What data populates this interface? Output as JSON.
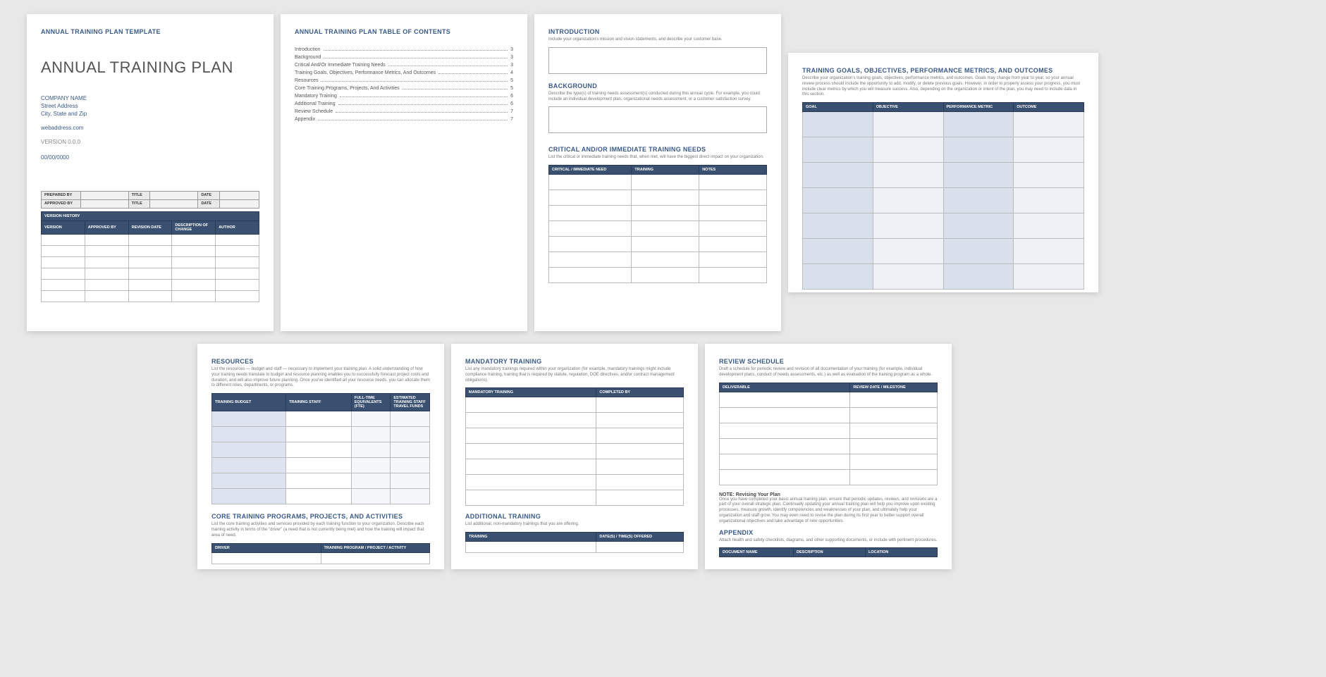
{
  "p1": {
    "top_label": "ANNUAL TRAINING PLAN TEMPLATE",
    "title": "ANNUAL TRAINING PLAN",
    "company": "COMPANY NAME",
    "addr1": "Street Address",
    "addr2": "City, State and Zip",
    "web": "webaddress.com",
    "version": "VERSION 0.0.0",
    "date": "00/00/0000",
    "sig": {
      "prepared": "PREPARED BY",
      "approved": "APPROVED BY",
      "title": "TITLE",
      "date": "DATE"
    },
    "vh_header": "VERSION HISTORY",
    "vh_cols": [
      "VERSION",
      "APPROVED BY",
      "REVISION DATE",
      "DESCRIPTION OF CHANGE",
      "AUTHOR"
    ]
  },
  "p2": {
    "title": "ANNUAL TRAINING PLAN TABLE OF CONTENTS",
    "items": [
      {
        "t": "Introduction",
        "p": "3"
      },
      {
        "t": "Background",
        "p": "3"
      },
      {
        "t": "Critical And/Or Immediate Training Needs",
        "p": "3"
      },
      {
        "t": "Training Goals, Objectives, Performance Metrics, And Outcomes",
        "p": "4"
      },
      {
        "t": "Resources",
        "p": "5"
      },
      {
        "t": "Core Training Programs, Projects, And Activities",
        "p": "5"
      },
      {
        "t": "Mandatory Training",
        "p": "6"
      },
      {
        "t": "Additional Training",
        "p": "6"
      },
      {
        "t": "Review Schedule",
        "p": "7"
      },
      {
        "t": "Appendix",
        "p": "7"
      }
    ]
  },
  "p3": {
    "intro_h": "INTRODUCTION",
    "intro_t": "Include your organization's mission and vision statements, and describe your customer base.",
    "bg_h": "BACKGROUND",
    "bg_t": "Describe the type(s) of training needs assessment(s) conducted during this annual cycle. For example, you could include an individual development plan, organizational needs assessment, or a customer satisfaction survey.",
    "crit_h": "CRITICAL AND/OR IMMEDIATE TRAINING NEEDS",
    "crit_t": "List the critical or immediate training needs that, when met, will have the biggest direct impact on your organization.",
    "crit_cols": [
      "CRITICAL / IMMEDIATE NEED",
      "TRAINING",
      "NOTES"
    ]
  },
  "p4": {
    "h": "TRAINING GOALS, OBJECTIVES, PERFORMANCE METRICS, AND OUTCOMES",
    "t": "Describe your organization's training goals, objectives, performance metrics, and outcomes. Goals may change from year to year, so your annual review process should include the opportunity to add, modify, or delete previous goals. However, in order to properly assess your progress, you must include clear metrics by which you will measure success. Also, depending on the organization or intent of the plan, you may need to include data in this section.",
    "cols": [
      "GOAL",
      "OBJECTIVE",
      "PERFORMANCE METRIC",
      "OUTCOME"
    ]
  },
  "p5": {
    "res_h": "RESOURCES",
    "res_t": "List the resources — budget and staff — necessary to implement your training plan. A solid understanding of how your training needs translate to budget and resource planning enables you to successfully forecast project costs and duration, and will also improve future planning. Once you've identified all your resource needs, you can allocate them to different roles, departments, or programs.",
    "res_cols": [
      "TRAINING BUDGET",
      "TRAINING STAFF",
      "FULL-TIME EQUIVALENTS (FTE)",
      "ESTIMATED TRAINING STAFF TRAVEL FUNDS"
    ],
    "core_h": "CORE TRAINING PROGRAMS, PROJECTS, AND ACTIVITIES",
    "core_t": "List the core training activities and services provided by each training function to your organization. Describe each training activity in terms of the \"driver\" (a need that is not currently being met) and how the training will impact that area of need.",
    "core_cols": [
      "DRIVER",
      "TRAINING PROGRAM / PROJECT / ACTIVITY"
    ]
  },
  "p6": {
    "man_h": "MANDATORY TRAINING",
    "man_t": "List any mandatory trainings required within your organization (for example, mandatory trainings might include compliance training, training that is required by statute, regulation, DOE directives, and/or contract management obligations).",
    "man_cols": [
      "MANDATORY TRAINING",
      "COMPLETED BY"
    ],
    "add_h": "ADDITIONAL TRAINING",
    "add_t": "List additional, non-mandatory trainings that you are offering.",
    "add_cols": [
      "TRAINING",
      "DATE(S) / TIME(S) OFFERED"
    ]
  },
  "p7": {
    "rev_h": "REVIEW SCHEDULE",
    "rev_t": "Draft a schedule for periodic review and revision of all documentation of your training (for example, individual development plans, conduct of needs assessments, etc.) as well as evaluation of the training program as a whole.",
    "rev_cols": [
      "DELIVERABLE",
      "REVIEW DATE / MILESTONE"
    ],
    "note_h": "NOTE: Revising Your Plan",
    "note_t": "Once you have completed your basic annual training plan, ensure that periodic updates, reviews, and revisions are a part of your overall strategic plan. Continually updating your annual training plan will help you improve upon existing processes, measure growth, identify competencies and weaknesses of your plan, and ultimately help your organization and staff grow. You may even need to revise the plan during its first year to better support overall organizational objectives and take advantage of new opportunities.",
    "app_h": "APPENDIX",
    "app_t": "Attach health and safety checklists, diagrams, and other supporting documents, or include with pertinent procedures.",
    "app_cols": [
      "DOCUMENT NAME",
      "DESCRIPTION",
      "LOCATION"
    ]
  }
}
